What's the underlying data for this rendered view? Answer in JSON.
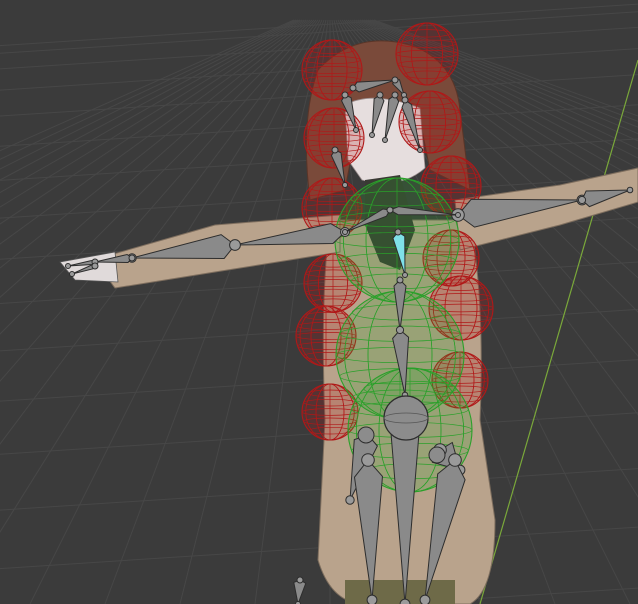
{
  "viewport": {
    "kind": "3D viewport",
    "background_color": "#3b3b3b",
    "grid_color": "#474747",
    "y_axis_color": "#7aa83a"
  },
  "icons": [
    "head-collider-icon",
    "arm-bone-icon",
    "leg-bone-icon",
    "spine-bone-icon",
    "physics-sphere-icon"
  ],
  "colors": {
    "skin": "#e6dede",
    "coat": "#b9a38c",
    "coat_shade": "#8f7e6b",
    "hair": "#7a4a3a",
    "red_collider": "#b01818",
    "green_collider": "#2aa02a",
    "bone_fill": "#8a8a8a",
    "bone_stroke": "#2d2d2d",
    "selected_bone": "#7fe0e8"
  }
}
